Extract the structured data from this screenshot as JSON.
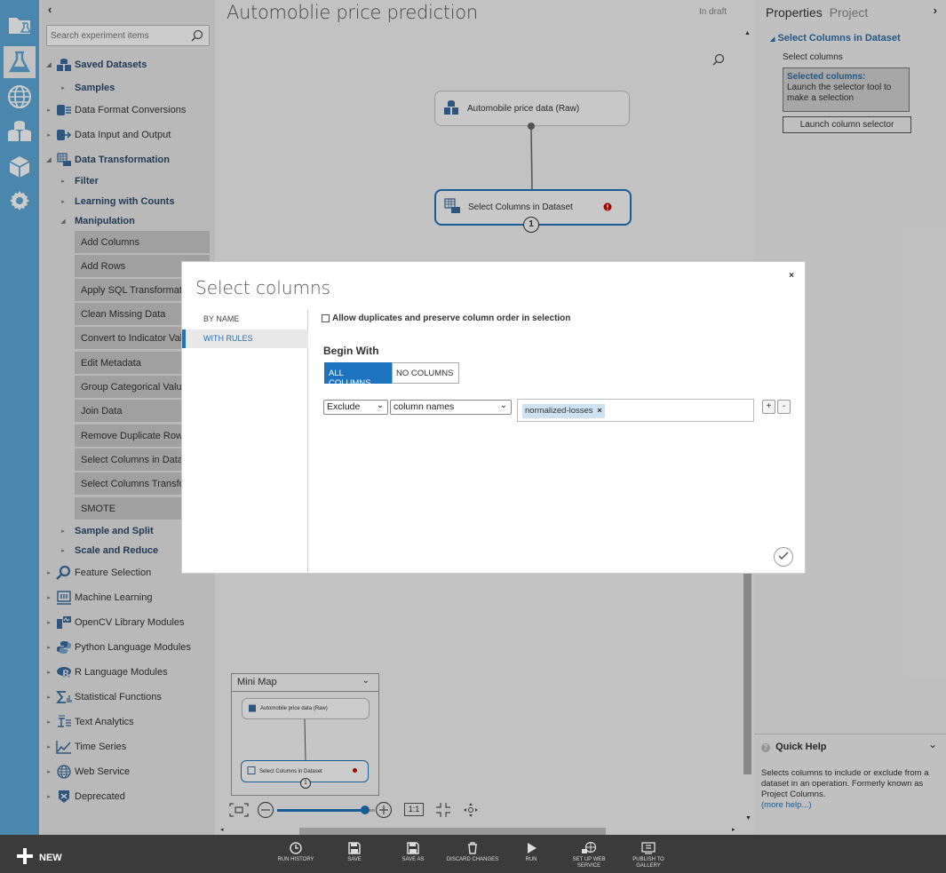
{
  "rail": {
    "icons": [
      "projects-icon",
      "experiments-icon",
      "web-services-icon",
      "datasets-icon",
      "trained-models-icon",
      "settings-icon"
    ],
    "active_color": "#5ea9d9"
  },
  "palette": {
    "collapse_glyph": "‹",
    "search_placeholder": "Search experiment items",
    "items": [
      {
        "label": "Saved Datasets"
      },
      {
        "label": "Samples"
      },
      {
        "label": "Data Format Conversions"
      },
      {
        "label": "Data Input and Output"
      },
      {
        "label": "Data Transformation"
      },
      {
        "label": "Filter"
      },
      {
        "label": "Learning with Counts"
      },
      {
        "label": "Manipulation"
      },
      {
        "label": "Sample and Split"
      },
      {
        "label": "Scale and Reduce"
      },
      {
        "label": "Feature Selection"
      },
      {
        "label": "Machine Learning"
      },
      {
        "label": "OpenCV Library Modules"
      },
      {
        "label": "Python Language Modules"
      },
      {
        "label": "R Language Modules"
      },
      {
        "label": "Statistical Functions"
      },
      {
        "label": "Text Analytics"
      },
      {
        "label": "Time Series"
      },
      {
        "label": "Web Service"
      },
      {
        "label": "Deprecated"
      }
    ],
    "modules": [
      "Add Columns",
      "Add Rows",
      "Apply SQL Transformation",
      "Clean Missing Data",
      "Convert to Indicator Values",
      "Edit Metadata",
      "Group Categorical Values",
      "Join Data",
      "Remove Duplicate Rows",
      "Select Columns in Dataset",
      "Select Columns Transform",
      "SMOTE"
    ]
  },
  "canvas": {
    "title": "Automoblie price prediction",
    "status": "In draft",
    "node1_label": "Automobile price data (Raw)",
    "node2_label": "Select Columns in Dataset",
    "node2_port": "1",
    "minimap": {
      "title": "Mini Map",
      "node1": "Automobile price data (Raw)",
      "node2": "Select Columns in Dataset",
      "port": "1"
    },
    "zoom_level": 0.35,
    "zoom_actual_label": "1:1"
  },
  "properties": {
    "tab_properties": "Properties",
    "tab_project": "Project",
    "section": "Select Columns in Dataset",
    "field_label": "Select columns",
    "selected_title": "Selected columns:",
    "selected_text": "Launch the selector tool to make a selection",
    "launch_button": "Launch column selector",
    "quick_help_title": "Quick Help",
    "quick_help_text": "Selects columns to include or exclude from a dataset in an operation. Formerly known as Project Columns.",
    "quick_help_more": "(more help...)"
  },
  "dialog": {
    "title": "Select columns",
    "close": "×",
    "nav": [
      "BY NAME",
      "WITH RULES"
    ],
    "allow_dupes": "Allow duplicates and preserve column order in selection",
    "begin_with": "Begin With",
    "all_columns": "ALL COLUMNS",
    "no_columns": "NO COLUMNS",
    "rule_action": "Exclude",
    "rule_type": "column names",
    "tag": "normalized-losses",
    "plus": "+",
    "minus": "-"
  },
  "bottombar": {
    "new_label": "NEW",
    "buttons": [
      "RUN HISTORY",
      "SAVE",
      "SAVE AS",
      "DISCARD CHANGES",
      "RUN",
      "SET UP WEB SERVICE",
      "PUBLISH TO GALLERY"
    ]
  }
}
